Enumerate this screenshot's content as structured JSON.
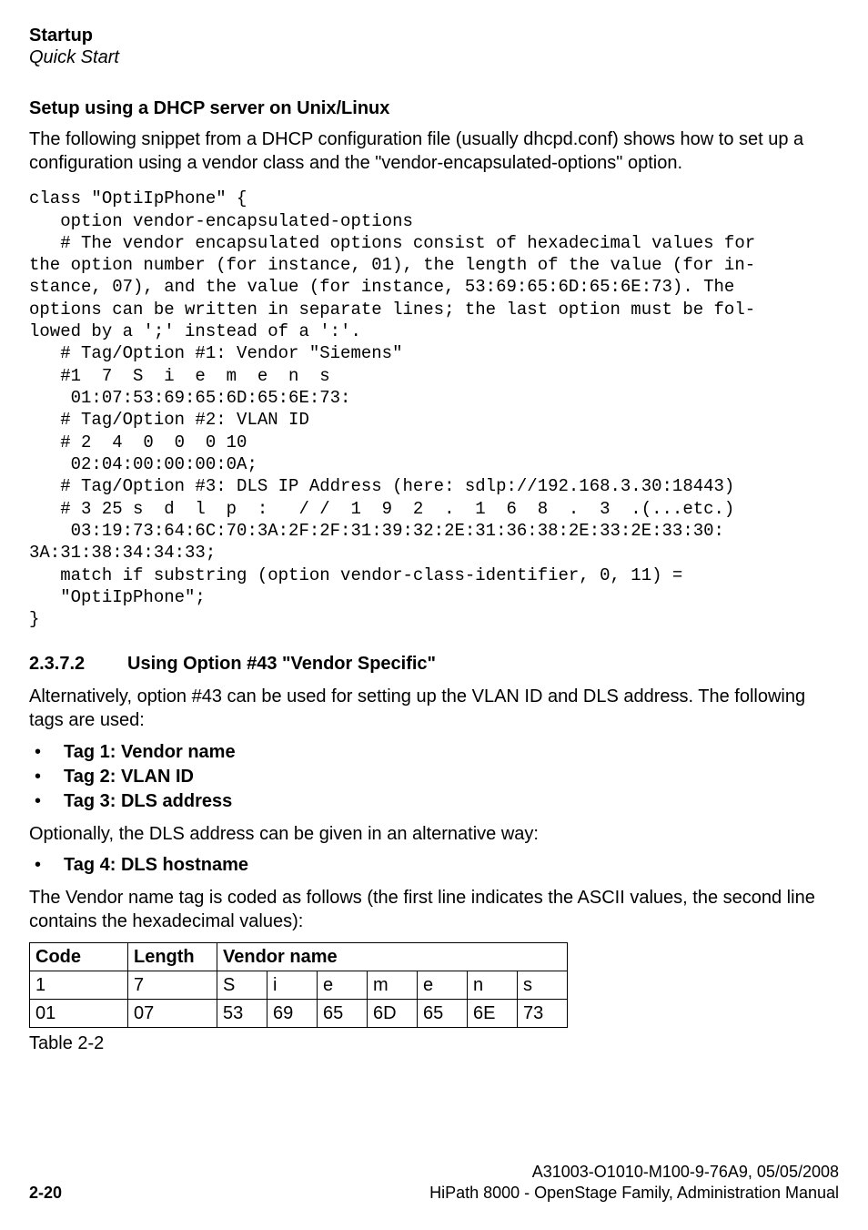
{
  "header": {
    "bold": "Startup",
    "italic": "Quick Start"
  },
  "section1": {
    "title": "Setup using a DHCP server on Unix/Linux",
    "paragraph": "The following snippet from a DHCP configuration file (usually dhcpd.conf) shows how to set up a configuration using a vendor class and the \"vendor-encapsulated-options\" option."
  },
  "code": "class \"OptiIpPhone\" {\n   option vendor-encapsulated-options\n   # The vendor encapsulated options consist of hexadecimal values for\nthe option number (for instance, 01), the length of the value (for in-\nstance, 07), and the value (for instance, 53:69:65:6D:65:6E:73). The\noptions can be written in separate lines; the last option must be fol-\nlowed by a ';' instead of a ':'.\n   # Tag/Option #1: Vendor \"Siemens\"\n   #1  7  S  i  e  m  e  n  s\n    01:07:53:69:65:6D:65:6E:73:\n   # Tag/Option #2: VLAN ID\n   # 2  4  0  0  0 10\n    02:04:00:00:00:0A;\n   # Tag/Option #3: DLS IP Address (here: sdlp://192.168.3.30:18443)\n   # 3 25 s  d  l  p  :   / /  1  9  2  .  1  6  8  .  3  .(...etc.)\n    03:19:73:64:6C:70:3A:2F:2F:31:39:32:2E:31:36:38:2E:33:2E:33:30:\n3A:31:38:34:34:33;\n   match if substring (option vendor-class-identifier, 0, 11) = \n   \"OptiIpPhone\";\n}",
  "section2": {
    "number": "2.3.7.2",
    "title": "Using Option #43 \"Vendor Specific\"",
    "paragraph1": "Alternatively, option #43 can be used for setting up the VLAN ID and DLS address. The following tags are used:",
    "bullets1": [
      "Tag 1: Vendor name",
      "Tag 2: VLAN ID",
      "Tag 3: DLS address"
    ],
    "paragraph2": "Optionally, the DLS address can be given in an alternative way:",
    "bullets2": [
      "Tag 4: DLS hostname"
    ],
    "paragraph3": "The Vendor name tag is coded as follows (the first line indicates the ASCII values, the second line contains the hexadecimal values):"
  },
  "table": {
    "headers": {
      "code": "Code",
      "length": "Length",
      "vendor": "Vendor name"
    },
    "row_ascii": {
      "code": "1",
      "length": "7",
      "cells": [
        "S",
        "i",
        "e",
        "m",
        "e",
        "n",
        "s"
      ]
    },
    "row_hex": {
      "code": "01",
      "length": "07",
      "cells": [
        "53",
        "69",
        "65",
        "6D",
        "65",
        "6E",
        "73"
      ]
    },
    "caption": "Table 2-2"
  },
  "footer": {
    "page": "2-20",
    "line1": "A31003-O1010-M100-9-76A9, 05/05/2008",
    "line2": "HiPath 8000 - OpenStage Family, Administration Manual"
  },
  "colwidths": {
    "code": "95",
    "length": "85",
    "vendor_cell": "42"
  }
}
